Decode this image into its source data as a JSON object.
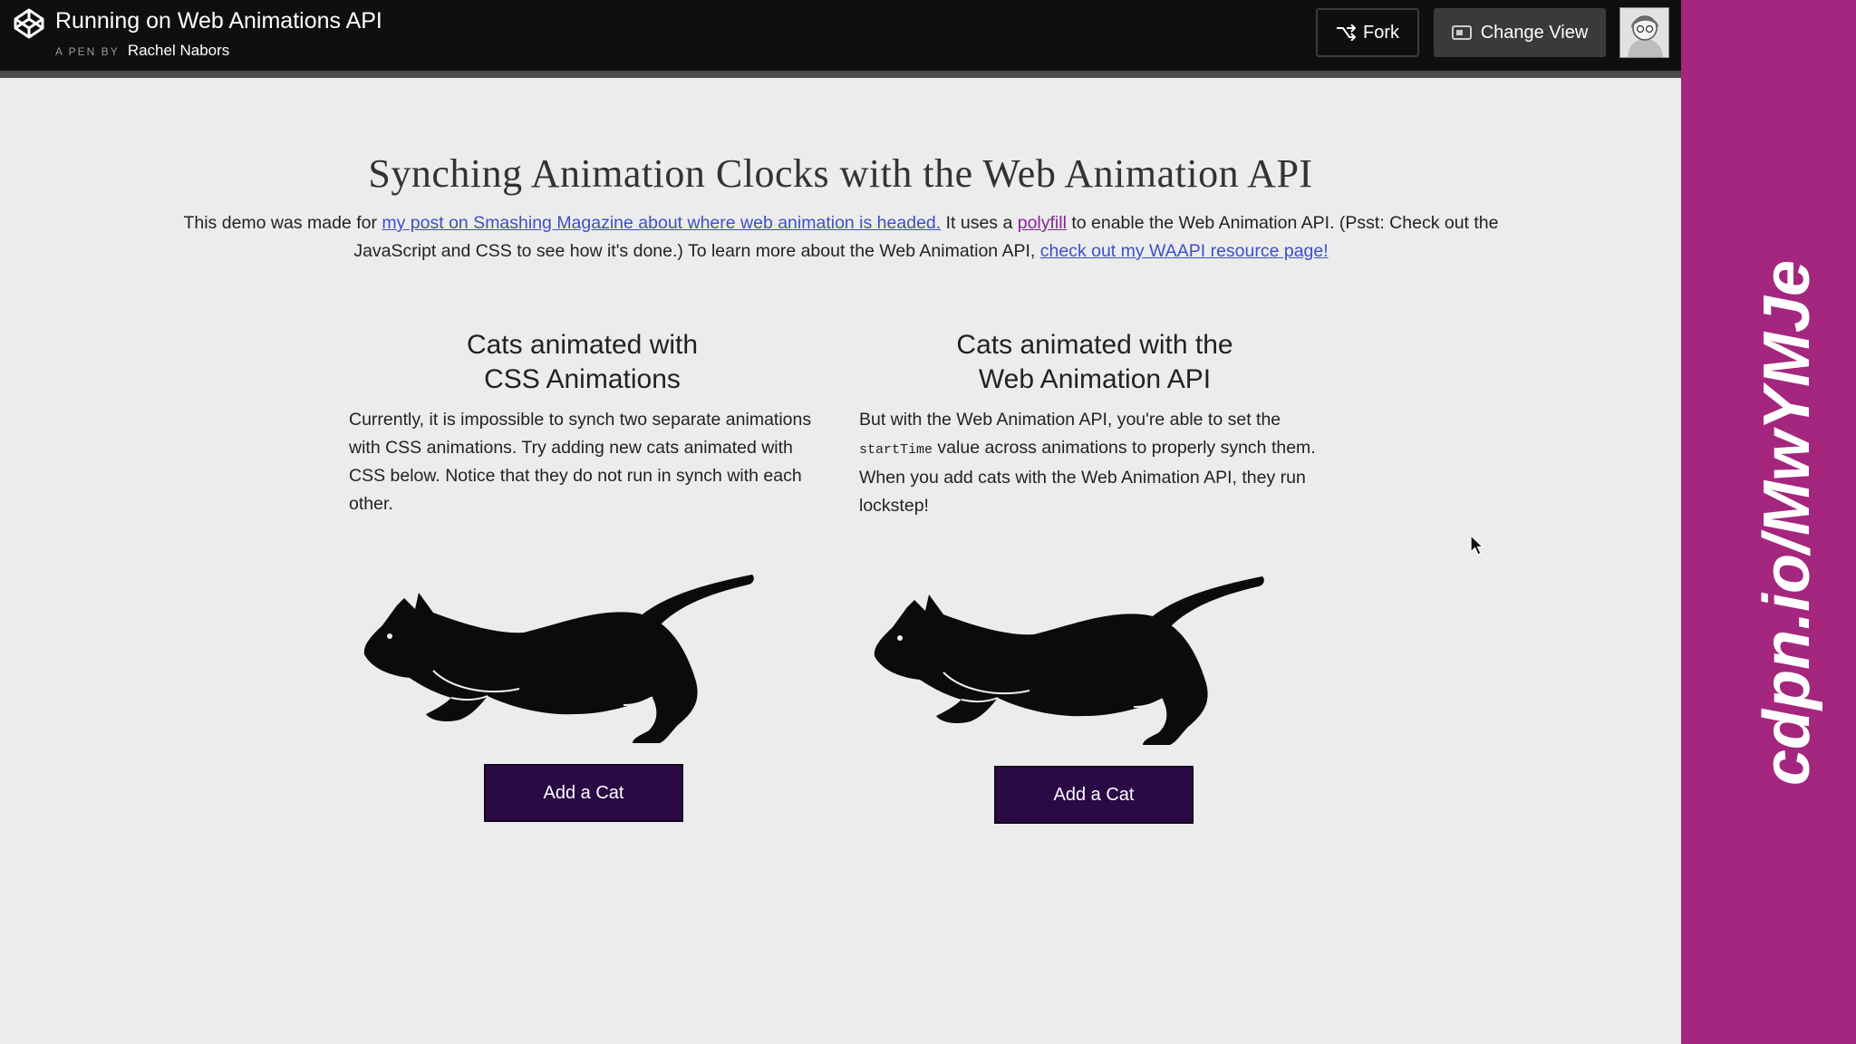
{
  "topbar": {
    "pen_title": "Running on Web Animations API",
    "pen_by": "A PEN BY",
    "author": "Rachel Nabors",
    "fork_label": "Fork",
    "change_view_label": "Change View"
  },
  "side_panel": {
    "url_text": "cdpn.io/MwYMJe"
  },
  "main": {
    "heading": "Synching Animation Clocks with the Web Animation API",
    "intro": {
      "p1": "This demo was made for ",
      "link1": "my post on Smashing Magazine about where web animation is headed.",
      "p2": " It uses a ",
      "link2": "polyfill",
      "p3": " to enable the Web Animation API. (Psst: Check out the JavaScript and CSS to see how it's done.) To learn more about the Web Animation API, ",
      "link3": "check out my WAAPI resource page!"
    },
    "left": {
      "title_line1": "Cats animated with",
      "title_line2": "CSS Animations",
      "text": "Currently, it is impossible to synch two separate animations with CSS animations. Try adding new cats animated with CSS below. Notice that they do not run in synch with each other.",
      "button": "Add a Cat"
    },
    "right": {
      "title_line1": "Cats animated with the",
      "title_line2": "Web Animation API",
      "text_pre": "But with the Web Animation API, you're able to set the ",
      "code": "startTime",
      "text_post": " value across animations to properly synch them. When you add cats with the Web Animation API, they run lockstep!",
      "button": "Add a Cat"
    }
  },
  "colors": {
    "topbar": "#0f0f0f",
    "side_panel": "#a5267e",
    "button": "#2a0a45",
    "link": "#3b50c7",
    "visited_link": "#8a2399"
  }
}
